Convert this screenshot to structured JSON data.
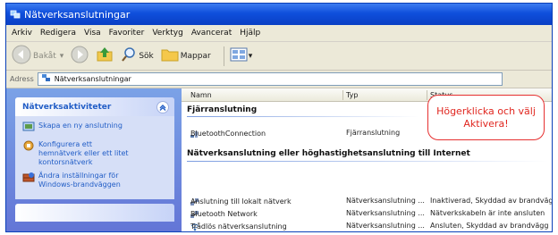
{
  "window": {
    "title": "Nätverksanslutningar"
  },
  "menu": [
    "Arkiv",
    "Redigera",
    "Visa",
    "Favoriter",
    "Verktyg",
    "Avancerat",
    "Hjälp"
  ],
  "toolbar": {
    "back_label": "Bakåt",
    "search_label": "Sök",
    "folders_label": "Mappar"
  },
  "address": {
    "label": "Adress",
    "value": "Nätverksanslutningar"
  },
  "tasks": {
    "title": "Nätverksaktiviteter",
    "items": [
      {
        "label": "Skapa en ny anslutning",
        "icon": "new-connection-icon"
      },
      {
        "label": "Konfigurera ett\nhemnätverk eller ett litet\nkontorsnätverk",
        "icon": "home-network-icon"
      },
      {
        "label": "Ändra inställningar för\nWindows-brandväggen",
        "icon": "firewall-icon"
      }
    ]
  },
  "list": {
    "columns": [
      "Namn",
      "Typ",
      "Status"
    ],
    "group1": "Fjärranslutning",
    "group2": "Nätverksanslutning eller höghastighetsanslutning till Internet",
    "rows_group1": [
      {
        "name": "BluetoothConnection",
        "type": "Fjärranslutning",
        "status": ""
      }
    ],
    "rows_group2": [
      {
        "name": "Anslutning till lokalt nätverk",
        "type": "Nätverksanslutning ...",
        "status": "Inaktiverad, Skyddad av brandvägg"
      },
      {
        "name": "Bluetooth Network",
        "type": "Nätverksanslutning ...",
        "status": "Nätverkskabeln är inte ansluten"
      },
      {
        "name": "Trådlös nätverksanslutning",
        "type": "Nätverksanslutning ...",
        "status": "Ansluten, Skyddad av brandvägg"
      }
    ]
  },
  "callout": {
    "line1": "Högerklicka och välj",
    "line2": "Aktivera!"
  },
  "colors": {
    "title_bar": "#0f4fdc",
    "task_pane": "#6f8ee0",
    "callout": "#e0261f"
  }
}
